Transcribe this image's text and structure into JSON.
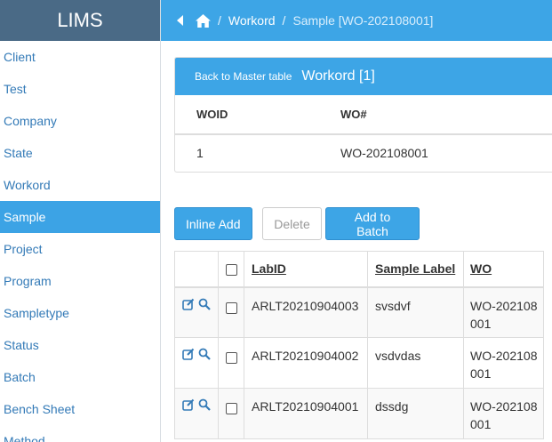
{
  "sidebar": {
    "brand": "LIMS",
    "items": [
      {
        "label": "Client",
        "active": false
      },
      {
        "label": "Test",
        "active": false
      },
      {
        "label": "Company",
        "active": false
      },
      {
        "label": "State",
        "active": false
      },
      {
        "label": "Workord",
        "active": false
      },
      {
        "label": "Sample",
        "active": true
      },
      {
        "label": "Project",
        "active": false
      },
      {
        "label": "Program",
        "active": false
      },
      {
        "label": "Sampletype",
        "active": false
      },
      {
        "label": "Status",
        "active": false
      },
      {
        "label": "Batch",
        "active": false
      },
      {
        "label": "Bench Sheet",
        "active": false
      },
      {
        "label": "Method",
        "active": false
      }
    ]
  },
  "breadcrumb": {
    "sep": "/",
    "items": [
      "Workord",
      "Sample [WO-202108001]"
    ]
  },
  "master": {
    "back_label": "Back to Master table",
    "title": "Workord [1]",
    "headers": [
      "WOID",
      "WO#"
    ],
    "row": [
      "1",
      "WO-202108001"
    ]
  },
  "toolbar": {
    "inline_add": "Inline Add",
    "delete": "Delete",
    "add_to_batch": "Add to Batch"
  },
  "detail": {
    "headers": {
      "labid": "LabID",
      "sample_label": "Sample Label",
      "wo": "WO"
    },
    "rows": [
      {
        "labid": "ARLT20210904003",
        "sample_label": "svsdvf",
        "wo": "WO-202108001"
      },
      {
        "labid": "ARLT20210904002",
        "sample_label": "vsdvdas",
        "wo": "WO-202108001"
      },
      {
        "labid": "ARLT20210904001",
        "sample_label": "dssdg",
        "wo": "WO-202108001"
      }
    ]
  },
  "icons": [
    "home-icon",
    "back-arrow-icon",
    "edit-icon",
    "search-icon"
  ],
  "colors": {
    "accent": "#3da5e6",
    "brand_bg": "#4a6a86",
    "link": "#337ab7"
  }
}
